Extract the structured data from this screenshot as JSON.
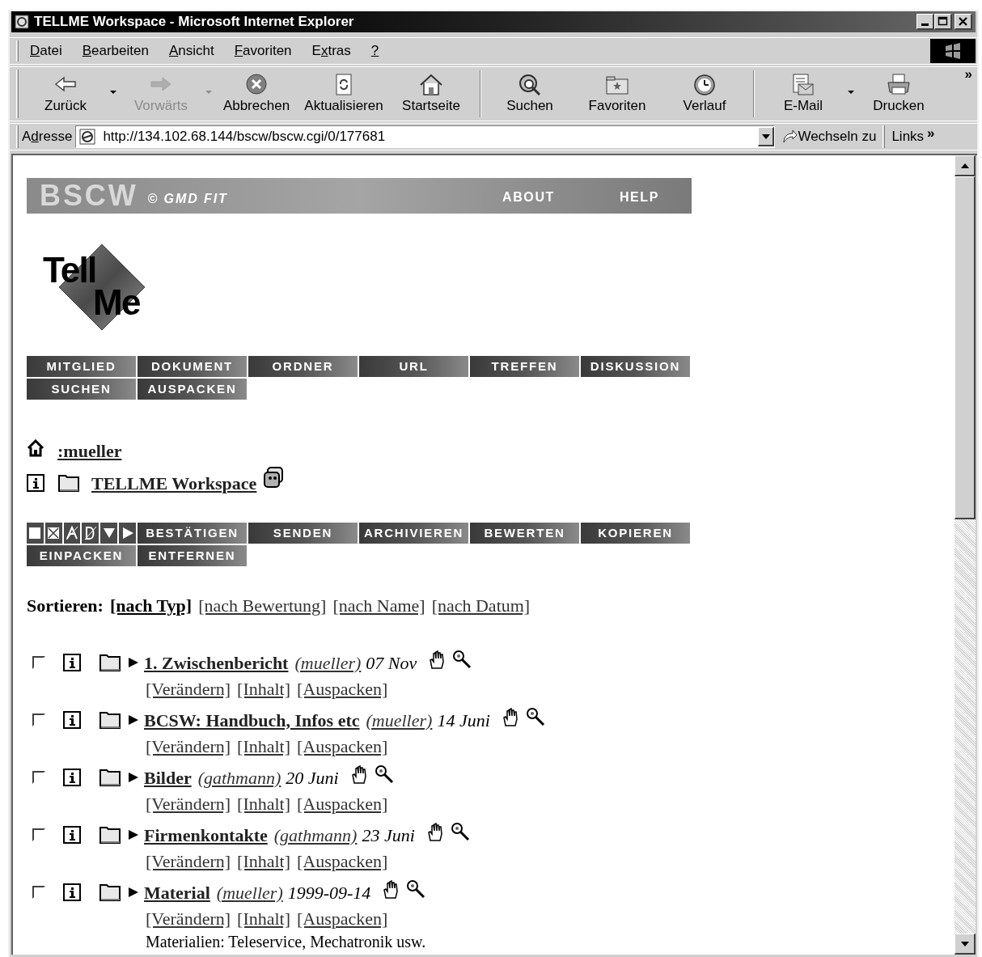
{
  "window": {
    "title": "TELLME Workspace - Microsoft Internet Explorer"
  },
  "menu": [
    {
      "key": "D",
      "after": "atei"
    },
    {
      "key": "B",
      "after": "earbeiten"
    },
    {
      "key": "A",
      "after": "nsicht"
    },
    {
      "key": "F",
      "after": "avoriten"
    },
    {
      "before": "E",
      "key": "x",
      "after": "tras"
    },
    {
      "key": "?"
    }
  ],
  "toolbar": [
    {
      "kind": "button",
      "label": "Zurück",
      "disabled": false,
      "dropdown": true
    },
    {
      "kind": "button",
      "label": "Vorwärts",
      "disabled": true,
      "dropdown": true
    },
    {
      "kind": "button",
      "label": "Abbrechen",
      "disabled": false,
      "dropdown": false
    },
    {
      "kind": "button",
      "label": "Aktualisieren",
      "disabled": false,
      "dropdown": false
    },
    {
      "kind": "button",
      "label": "Startseite",
      "disabled": false,
      "dropdown": false
    },
    {
      "kind": "separator"
    },
    {
      "kind": "button",
      "label": "Suchen",
      "disabled": false,
      "dropdown": false
    },
    {
      "kind": "button",
      "label": "Favoriten",
      "disabled": false,
      "dropdown": false
    },
    {
      "kind": "button",
      "label": "Verlauf",
      "disabled": false,
      "dropdown": false
    },
    {
      "kind": "separator"
    },
    {
      "kind": "button",
      "label": "E-Mail",
      "disabled": false,
      "dropdown": true
    },
    {
      "kind": "button",
      "label": "Drucken",
      "disabled": false,
      "dropdown": false
    }
  ],
  "toolbar_more": "»",
  "address": {
    "label": {
      "before": "A",
      "key": "d",
      "after": "resse"
    },
    "url": "http://134.102.68.144/bscw/bscw.cgi/0/177681",
    "go": "Wechseln zu",
    "links": "Links",
    "links_more": "»"
  },
  "page": {
    "banner": {
      "brand": "BSCW",
      "copyright": "© GMD FIT",
      "links": [
        "ABOUT",
        "HELP"
      ]
    },
    "logo": [
      "Tell",
      "Me"
    ],
    "nav": [
      [
        "MITGLIED",
        "DOKUMENT",
        "ORDNER",
        "URL",
        "TREFFEN",
        "DISKUSSION"
      ],
      [
        "SUCHEN",
        "AUSPACKEN"
      ]
    ],
    "breadcrumb": {
      "home": ":mueller",
      "folder": "TELLME Workspace"
    },
    "actions": [
      [
        "BESTÄTIGEN",
        "SENDEN",
        "ARCHIVIEREN",
        "BEWERTEN",
        "KOPIEREN"
      ],
      [
        "EINPACKEN",
        "ENTFERNEN"
      ]
    ],
    "sort": {
      "label": "Sortieren:",
      "options": [
        {
          "label": "[nach Typ]",
          "selected": true
        },
        {
          "label": "[nach Bewertung]",
          "selected": false
        },
        {
          "label": "[nach Name]",
          "selected": false
        },
        {
          "label": "[nach Datum]",
          "selected": false
        }
      ]
    },
    "items": [
      {
        "name": "1. Zwischenbericht",
        "owner": "(mueller)",
        "date": "07 Nov",
        "checked": false,
        "links": [
          "[Verändern]",
          "[Inhalt]",
          "[Auspacken]"
        ]
      },
      {
        "name": "BCSW: Handbuch, Infos etc",
        "owner": "(mueller)",
        "date": "14 Juni",
        "checked": false,
        "links": [
          "[Verändern]",
          "[Inhalt]",
          "[Auspacken]"
        ]
      },
      {
        "name": "Bilder",
        "owner": "(gathmann)",
        "date": "20 Juni",
        "checked": false,
        "links": [
          "[Verändern]",
          "[Inhalt]",
          "[Auspacken]"
        ]
      },
      {
        "name": "Firmenkontakte",
        "owner": "(gathmann)",
        "date": "23 Juni",
        "checked": false,
        "links": [
          "[Verändern]",
          "[Inhalt]",
          "[Auspacken]"
        ]
      },
      {
        "name": "Material",
        "owner": "(mueller)",
        "date": "1999-09-14",
        "checked": false,
        "links": [
          "[Verändern]",
          "[Inhalt]",
          "[Auspacken]"
        ],
        "description": "Materialien: Teleservice, Mechatronik usw."
      }
    ]
  }
}
